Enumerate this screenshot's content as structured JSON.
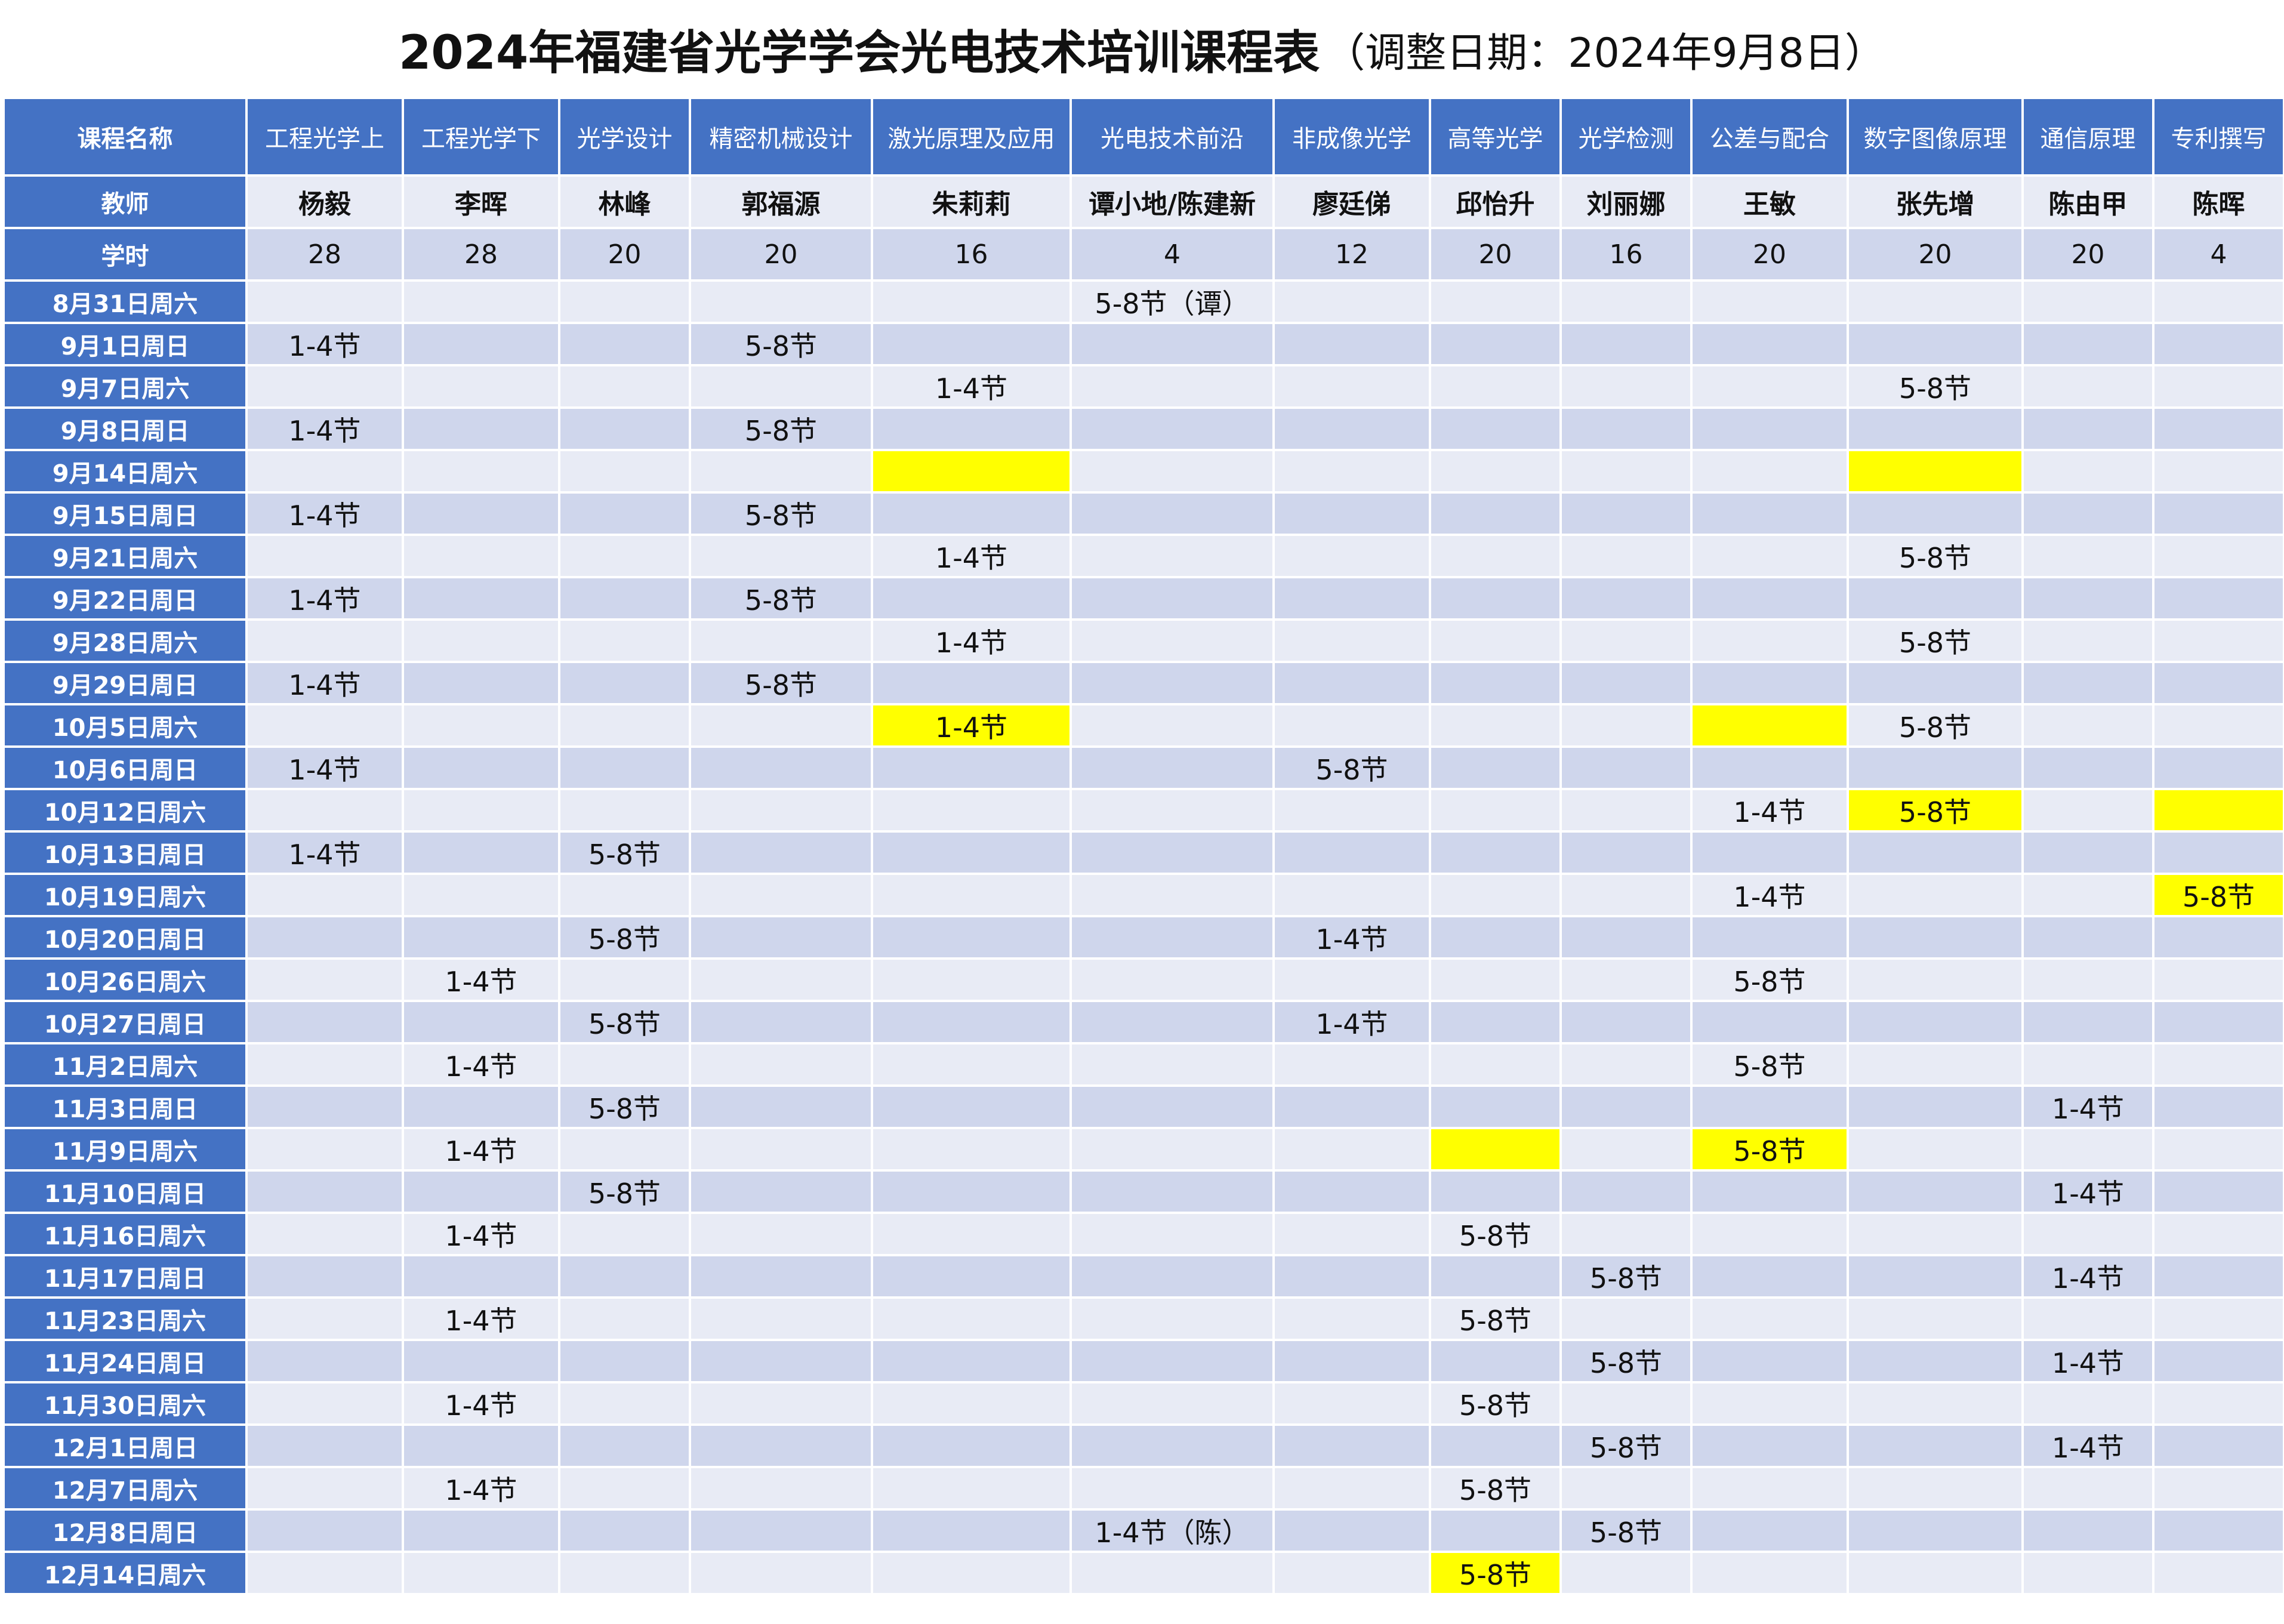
{
  "title": {
    "main": "2024年福建省光学学会光电技术培训课程表",
    "note": "（调整日期：2024年9月8日）"
  },
  "labels": {
    "course": "课程名称",
    "teacher": "教师",
    "hours": "学时"
  },
  "courses": [
    {
      "name": "工程光学上",
      "teacher": "杨毅",
      "hours": "28"
    },
    {
      "name": "工程光学下",
      "teacher": "李晖",
      "hours": "28"
    },
    {
      "name": "光学设计",
      "teacher": "林峰",
      "hours": "20"
    },
    {
      "name": "精密机械设计",
      "teacher": "郭福源",
      "hours": "20"
    },
    {
      "name": "激光原理及应用",
      "teacher": "朱莉莉",
      "hours": "16"
    },
    {
      "name": "光电技术前沿",
      "teacher": "谭小地/陈建新",
      "hours": "4"
    },
    {
      "name": "非成像光学",
      "teacher": "廖廷俤",
      "hours": "12"
    },
    {
      "name": "高等光学",
      "teacher": "邱怡升",
      "hours": "20"
    },
    {
      "name": "光学检测",
      "teacher": "刘丽娜",
      "hours": "16"
    },
    {
      "name": "公差与配合",
      "teacher": "王敏",
      "hours": "20"
    },
    {
      "name": "数字图像原理",
      "teacher": "张先增",
      "hours": "20"
    },
    {
      "name": "通信原理",
      "teacher": "陈由甲",
      "hours": "20"
    },
    {
      "name": "专利撰写",
      "teacher": "陈晖",
      "hours": "4"
    }
  ],
  "schedule": [
    {
      "date": "8月31日周六",
      "cells": [
        "",
        "",
        "",
        "",
        "",
        "5-8节（谭）",
        "",
        "",
        "",
        "",
        "",
        "",
        ""
      ],
      "highlight": []
    },
    {
      "date": "9月1日周日",
      "cells": [
        "1-4节",
        "",
        "",
        "5-8节",
        "",
        "",
        "",
        "",
        "",
        "",
        "",
        "",
        ""
      ],
      "highlight": []
    },
    {
      "date": "9月7日周六",
      "cells": [
        "",
        "",
        "",
        "",
        "1-4节",
        "",
        "",
        "",
        "",
        "",
        "5-8节",
        "",
        ""
      ],
      "highlight": []
    },
    {
      "date": "9月8日周日",
      "cells": [
        "1-4节",
        "",
        "",
        "5-8节",
        "",
        "",
        "",
        "",
        "",
        "",
        "",
        "",
        ""
      ],
      "highlight": []
    },
    {
      "date": "9月14日周六",
      "cells": [
        "",
        "",
        "",
        "",
        "",
        "",
        "",
        "",
        "",
        "",
        "",
        "",
        ""
      ],
      "highlight": [
        4,
        10
      ]
    },
    {
      "date": "9月15日周日",
      "cells": [
        "1-4节",
        "",
        "",
        "5-8节",
        "",
        "",
        "",
        "",
        "",
        "",
        "",
        "",
        ""
      ],
      "highlight": []
    },
    {
      "date": "9月21日周六",
      "cells": [
        "",
        "",
        "",
        "",
        "1-4节",
        "",
        "",
        "",
        "",
        "",
        "5-8节",
        "",
        ""
      ],
      "highlight": []
    },
    {
      "date": "9月22日周日",
      "cells": [
        "1-4节",
        "",
        "",
        "5-8节",
        "",
        "",
        "",
        "",
        "",
        "",
        "",
        "",
        ""
      ],
      "highlight": []
    },
    {
      "date": "9月28日周六",
      "cells": [
        "",
        "",
        "",
        "",
        "1-4节",
        "",
        "",
        "",
        "",
        "",
        "5-8节",
        "",
        ""
      ],
      "highlight": []
    },
    {
      "date": "9月29日周日",
      "cells": [
        "1-4节",
        "",
        "",
        "5-8节",
        "",
        "",
        "",
        "",
        "",
        "",
        "",
        "",
        ""
      ],
      "highlight": []
    },
    {
      "date": "10月5日周六",
      "cells": [
        "",
        "",
        "",
        "",
        "1-4节",
        "",
        "",
        "",
        "",
        "",
        "5-8节",
        "",
        ""
      ],
      "highlight": [
        4,
        9
      ]
    },
    {
      "date": "10月6日周日",
      "cells": [
        "1-4节",
        "",
        "",
        "",
        "",
        "",
        "5-8节",
        "",
        "",
        "",
        "",
        "",
        ""
      ],
      "highlight": []
    },
    {
      "date": "10月12日周六",
      "cells": [
        "",
        "",
        "",
        "",
        "",
        "",
        "",
        "",
        "",
        "1-4节",
        "5-8节",
        "",
        ""
      ],
      "highlight": [
        10,
        12
      ]
    },
    {
      "date": "10月13日周日",
      "cells": [
        "1-4节",
        "",
        "5-8节",
        "",
        "",
        "",
        "",
        "",
        "",
        "",
        "",
        "",
        ""
      ],
      "highlight": []
    },
    {
      "date": "10月19日周六",
      "cells": [
        "",
        "",
        "",
        "",
        "",
        "",
        "",
        "",
        "",
        "1-4节",
        "",
        "",
        "5-8节"
      ],
      "highlight": [
        12
      ]
    },
    {
      "date": "10月20日周日",
      "cells": [
        "",
        "",
        "5-8节",
        "",
        "",
        "",
        "1-4节",
        "",
        "",
        "",
        "",
        "",
        ""
      ],
      "highlight": []
    },
    {
      "date": "10月26日周六",
      "cells": [
        "",
        "1-4节",
        "",
        "",
        "",
        "",
        "",
        "",
        "",
        "5-8节",
        "",
        "",
        ""
      ],
      "highlight": []
    },
    {
      "date": "10月27日周日",
      "cells": [
        "",
        "",
        "5-8节",
        "",
        "",
        "",
        "1-4节",
        "",
        "",
        "",
        "",
        "",
        ""
      ],
      "highlight": []
    },
    {
      "date": "11月2日周六",
      "cells": [
        "",
        "1-4节",
        "",
        "",
        "",
        "",
        "",
        "",
        "",
        "5-8节",
        "",
        "",
        ""
      ],
      "highlight": []
    },
    {
      "date": "11月3日周日",
      "cells": [
        "",
        "",
        "5-8节",
        "",
        "",
        "",
        "",
        "",
        "",
        "",
        "",
        "1-4节",
        ""
      ],
      "highlight": []
    },
    {
      "date": "11月9日周六",
      "cells": [
        "",
        "1-4节",
        "",
        "",
        "",
        "",
        "",
        "",
        "",
        "5-8节",
        "",
        "",
        ""
      ],
      "highlight": [
        7,
        9
      ]
    },
    {
      "date": "11月10日周日",
      "cells": [
        "",
        "",
        "5-8节",
        "",
        "",
        "",
        "",
        "",
        "",
        "",
        "",
        "1-4节",
        ""
      ],
      "highlight": []
    },
    {
      "date": "11月16日周六",
      "cells": [
        "",
        "1-4节",
        "",
        "",
        "",
        "",
        "",
        "5-8节",
        "",
        "",
        "",
        "",
        ""
      ],
      "highlight": []
    },
    {
      "date": "11月17日周日",
      "cells": [
        "",
        "",
        "",
        "",
        "",
        "",
        "",
        "",
        "5-8节",
        "",
        "",
        "1-4节",
        ""
      ],
      "highlight": []
    },
    {
      "date": "11月23日周六",
      "cells": [
        "",
        "1-4节",
        "",
        "",
        "",
        "",
        "",
        "5-8节",
        "",
        "",
        "",
        "",
        ""
      ],
      "highlight": []
    },
    {
      "date": "11月24日周日",
      "cells": [
        "",
        "",
        "",
        "",
        "",
        "",
        "",
        "",
        "5-8节",
        "",
        "",
        "1-4节",
        ""
      ],
      "highlight": []
    },
    {
      "date": "11月30日周六",
      "cells": [
        "",
        "1-4节",
        "",
        "",
        "",
        "",
        "",
        "5-8节",
        "",
        "",
        "",
        "",
        ""
      ],
      "highlight": []
    },
    {
      "date": "12月1日周日",
      "cells": [
        "",
        "",
        "",
        "",
        "",
        "",
        "",
        "",
        "5-8节",
        "",
        "",
        "1-4节",
        ""
      ],
      "highlight": []
    },
    {
      "date": "12月7日周六",
      "cells": [
        "",
        "1-4节",
        "",
        "",
        "",
        "",
        "",
        "5-8节",
        "",
        "",
        "",
        "",
        ""
      ],
      "highlight": []
    },
    {
      "date": "12月8日周日",
      "cells": [
        "",
        "",
        "",
        "",
        "",
        "1-4节（陈）",
        "",
        "",
        "5-8节",
        "",
        "",
        "",
        ""
      ],
      "highlight": []
    },
    {
      "date": "12月14日周六",
      "cells": [
        "",
        "",
        "",
        "",
        "",
        "",
        "",
        "5-8节",
        "",
        "",
        "",
        "",
        ""
      ],
      "highlight": [
        7
      ]
    }
  ],
  "colors": {
    "header_blue": "#4472c4",
    "row_light": "#e8ebf5",
    "row_dark": "#cfd6ec",
    "highlight_yellow": "#ffff00"
  }
}
